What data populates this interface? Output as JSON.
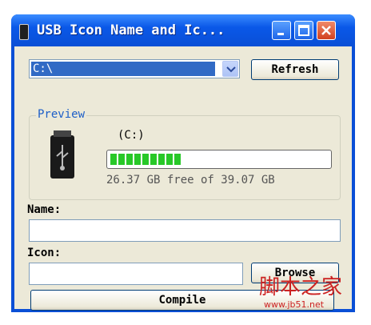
{
  "window": {
    "title": "USB Icon Name and Ic..."
  },
  "drive_combo": {
    "value": "C:\\"
  },
  "buttons": {
    "refresh": "Refresh",
    "browse": "Browse",
    "compile": "Compile"
  },
  "preview": {
    "group_label": "Preview",
    "drive_name": "(C:)",
    "usage_fraction": 0.33,
    "free_text": "26.37 GB free of 39.07 GB"
  },
  "fields": {
    "name_label": "Name:",
    "name_value": "",
    "icon_label": "Icon:",
    "icon_value": ""
  },
  "watermark": {
    "text": "脚本之家",
    "url": "www.jb51.net"
  }
}
